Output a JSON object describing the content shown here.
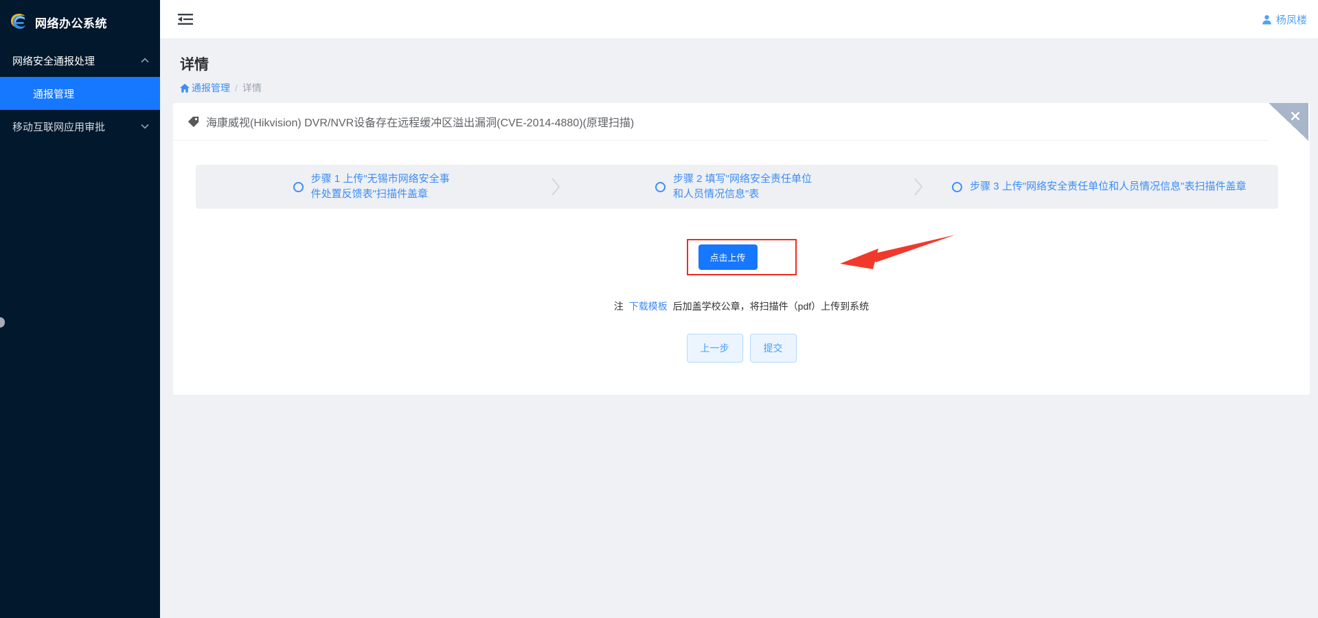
{
  "app": {
    "title": "网络办公系统",
    "user_name": "杨凤楼"
  },
  "sidebar": {
    "groups": [
      {
        "label": "网络安全通报处理",
        "state": "expanded"
      },
      {
        "label": "移动互联网应用审批",
        "state": "collapsed"
      }
    ],
    "active_item": {
      "label": "通报管理"
    }
  },
  "page": {
    "title": "详情",
    "breadcrumb": {
      "root": "通报管理",
      "separator": "/",
      "current": "详情"
    }
  },
  "card": {
    "title": "海康威视(Hikvision) DVR/NVR设备存在远程缓冲区溢出漏洞(CVE-2014-4880)(原理扫描)",
    "steps": [
      {
        "label": "步骤 1 上传\"无锡市网络安全事件处置反馈表\"扫描件盖章"
      },
      {
        "label": "步骤 2 填写\"网络安全责任单位和人员情况信息\"表"
      },
      {
        "label": "步骤 3 上传\"网络安全责任单位和人员情况信息\"表扫描件盖章"
      }
    ],
    "upload_button": "点击上传",
    "note": {
      "prefix": "注",
      "link": "下载模板",
      "suffix": "后加盖学校公章，将扫描件（pdf）上传到系统"
    },
    "prev_button": "上一步",
    "submit_button": "提交"
  },
  "colors": {
    "sidebar_bg": "#02182c",
    "accent_blue": "#1677ff",
    "step_blue": "#3d8cf5",
    "annotation_red": "#f02b1d",
    "page_bg": "#f0f1f5",
    "close_btn_gray": "#a9b6c9"
  }
}
